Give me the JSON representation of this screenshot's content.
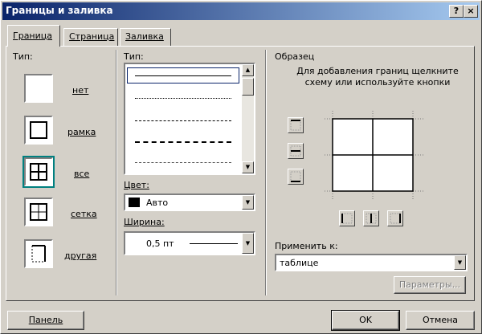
{
  "window": {
    "title": "Границы и заливка",
    "help": "?",
    "close": "×"
  },
  "tabs": [
    {
      "label": "Граница"
    },
    {
      "label": "Страница"
    },
    {
      "label": "Заливка"
    }
  ],
  "type_section": {
    "label": "Тип:",
    "settings": [
      {
        "label": "нет",
        "icon": "border-none-icon"
      },
      {
        "label": "рамка",
        "icon": "border-box-icon"
      },
      {
        "label": "все",
        "icon": "border-all-icon",
        "selected": true
      },
      {
        "label": "сетка",
        "icon": "border-grid-icon"
      },
      {
        "label": "другая",
        "icon": "border-custom-icon"
      }
    ]
  },
  "style_section": {
    "label": "Тип:",
    "color_label": "Цвет:",
    "color_value": "Авто",
    "width_label": "Ширина:",
    "width_value": "0,5 пт"
  },
  "preview": {
    "label": "Образец",
    "hint": "Для добавления границ щелкните схему или используйте кнопки",
    "apply_label": "Применить к:",
    "apply_value": "таблице",
    "params_button": "Параметры..."
  },
  "footer": {
    "panel_button": "Панель",
    "ok_button": "OK",
    "cancel_button": "Отмена"
  }
}
